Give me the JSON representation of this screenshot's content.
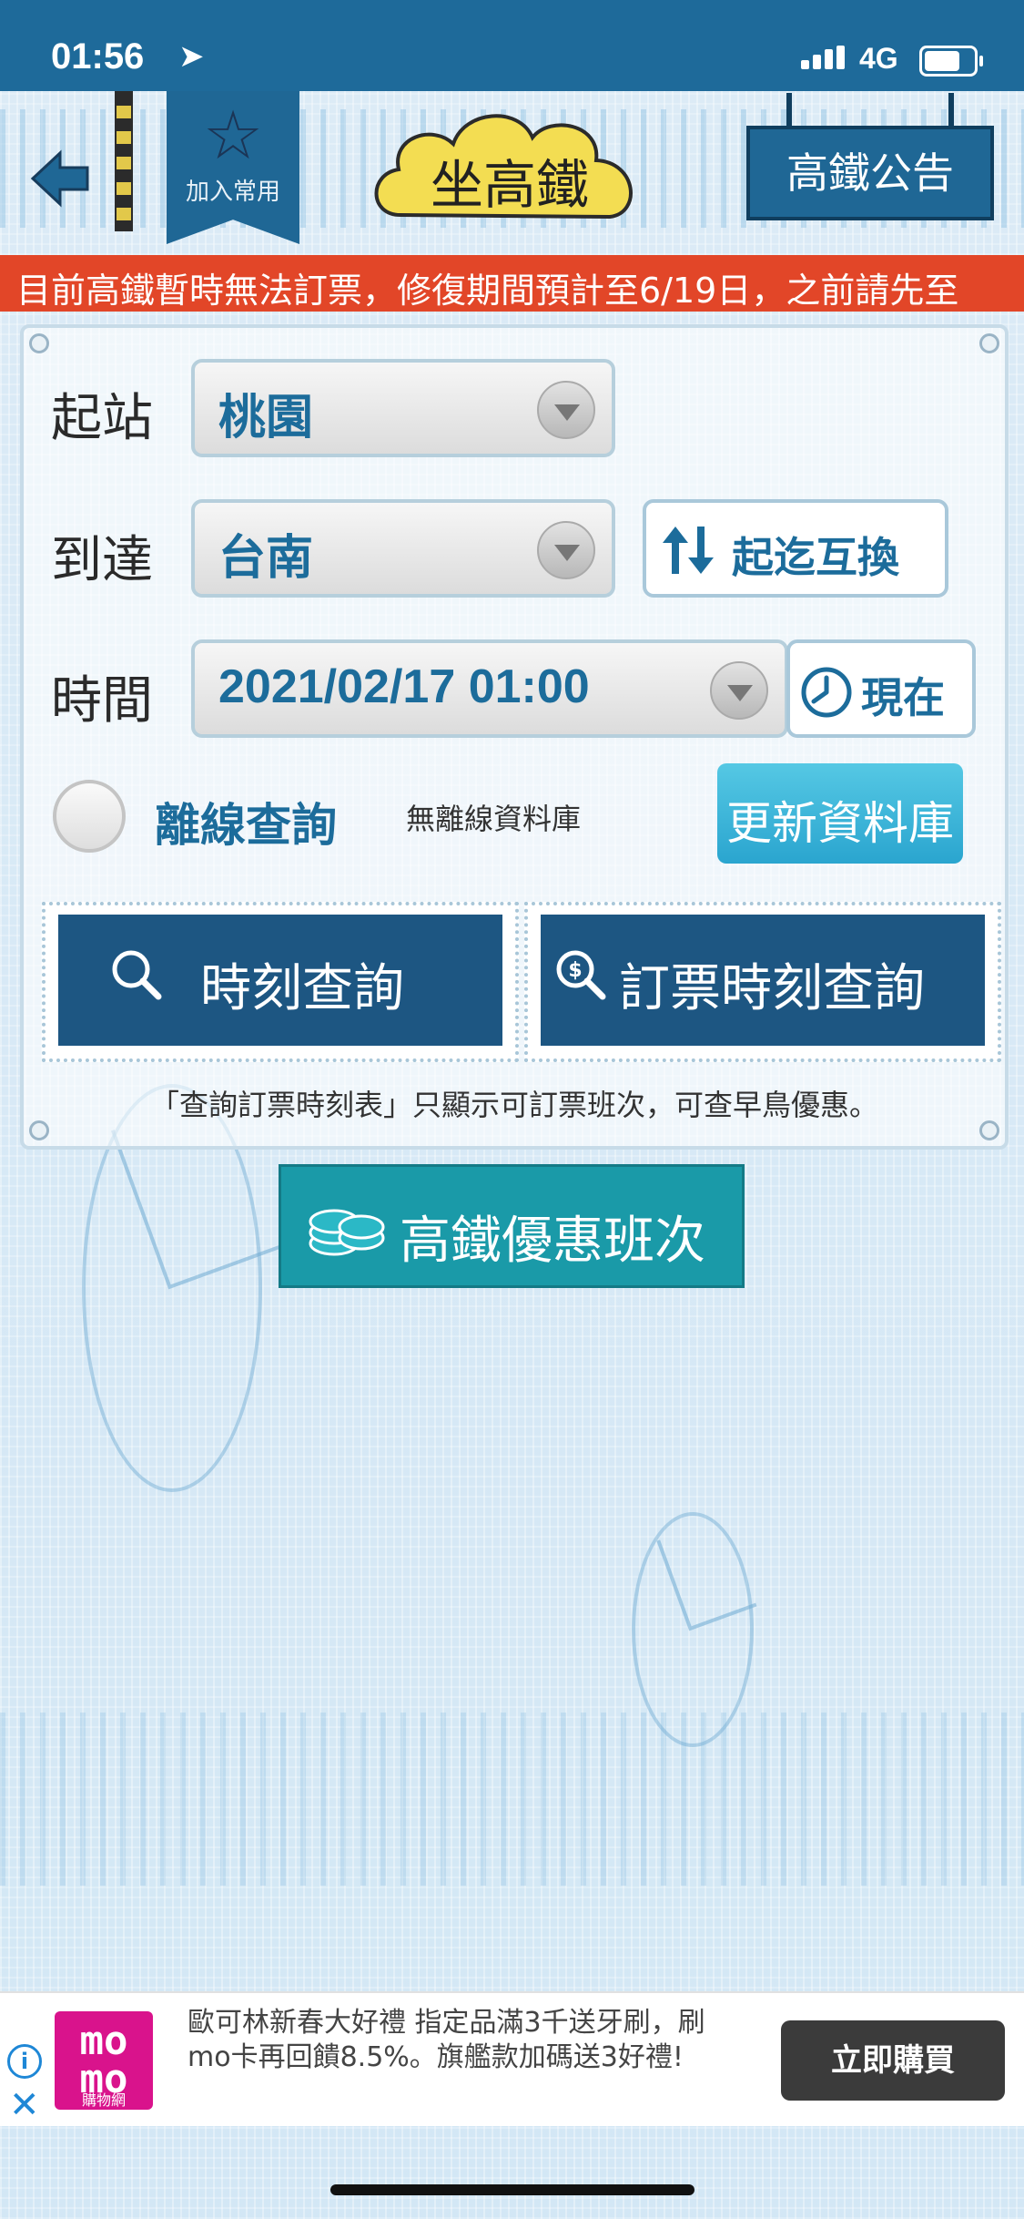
{
  "status": {
    "time": "01:56",
    "network": "4G"
  },
  "header": {
    "favorite_label": "加入常用",
    "title": "坐高鐵",
    "notice_button": "高鐵公告"
  },
  "marquee": {
    "text": "目前高鐵暫時無法訂票，修復期間預計至6/19日，之前請先至"
  },
  "form": {
    "from_label": "起站",
    "from_value": "桃園",
    "to_label": "到達",
    "to_value": "台南",
    "swap_button": "起迄互換",
    "time_label": "時間",
    "time_value": "2021/02/17 01:00",
    "now_button": "現在",
    "offline_label": "離線查詢",
    "offline_status": "無離線資料庫",
    "update_db_button": "更新資料庫"
  },
  "actions": {
    "timetable_query": "時刻查詢",
    "booking_query": "訂票時刻查詢",
    "hint": "「查詢訂票時刻表」只顯示可訂票班次，可查早鳥優惠。",
    "deals_button": "高鐵優惠班次"
  },
  "ad": {
    "logo_main": "mo\nmo",
    "logo_sub": "購物網",
    "text": "歐可林新春大好禮 指定品滿3千送牙刷，刷mo卡再回饋8.5%。旗艦款加碼送3好禮!",
    "cta": "立即購買"
  },
  "colors": {
    "status_bar": "#1e6a9a",
    "accent_blue": "#1c6c9b",
    "marquee_red": "#e24628",
    "button_navy": "#1d5682",
    "deal_teal": "#1a9aa8"
  }
}
